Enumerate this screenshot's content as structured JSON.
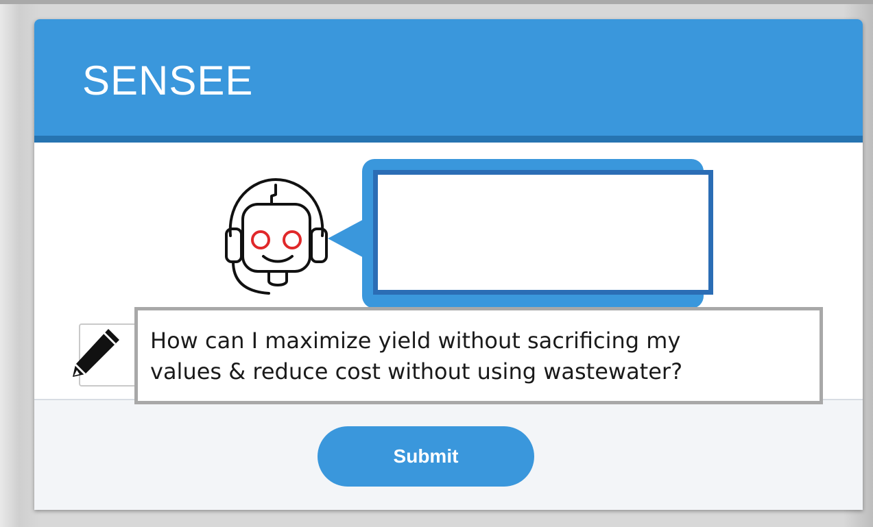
{
  "app": {
    "title": "SENSEE"
  },
  "assistant": {
    "icon": "robot-headset-icon",
    "bubble_text": ""
  },
  "question": {
    "text_line_1": "How can I maximize yield without sacrificing my",
    "text_line_2": "values & reduce cost without using wastewater?",
    "icon": "pencil-icon"
  },
  "actions": {
    "submit_label": "Submit"
  },
  "colors": {
    "header": "#3a97dc",
    "header_underline": "#2674b1",
    "bubble_border": "#2b6db5",
    "robot_eyes": "#e0282a",
    "question_border": "#a8a8a8"
  }
}
